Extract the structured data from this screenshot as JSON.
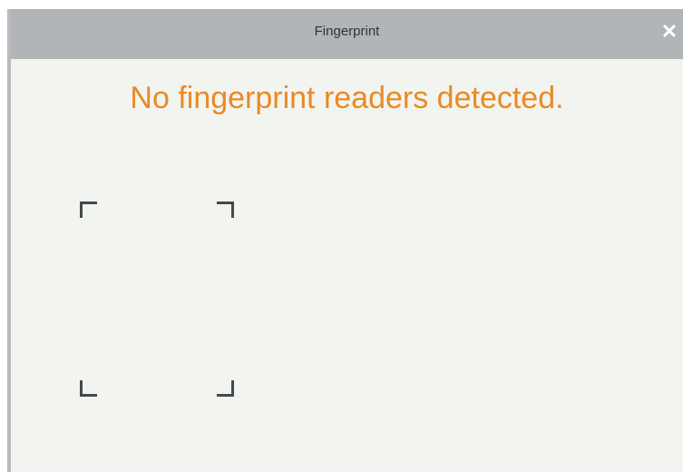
{
  "dialog": {
    "title": "Fingerprint",
    "close_icon": "close-icon",
    "close_glyph": "✕",
    "message": "No fingerprint readers detected.",
    "colors": {
      "titlebar": "#b1b5b8",
      "body": "#f2f4f0",
      "message": "#e98a25",
      "corners": "#45484c"
    }
  }
}
